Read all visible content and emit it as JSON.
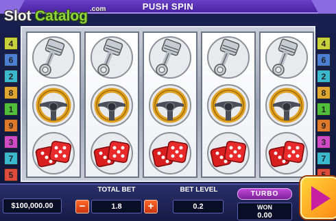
{
  "topbar": {
    "label": "PUSH SPIN"
  },
  "logo": {
    "part1": "Slot",
    "part2": "Catalog",
    "suffix": ".com"
  },
  "paylines": {
    "left": [
      {
        "n": "4",
        "color": "#c8d03a"
      },
      {
        "n": "6",
        "color": "#4a7fd4"
      },
      {
        "n": "2",
        "color": "#3ab8d0"
      },
      {
        "n": "8",
        "color": "#e0a830"
      },
      {
        "n": "1",
        "color": "#4fbf3a"
      },
      {
        "n": "9",
        "color": "#e07a2a"
      },
      {
        "n": "3",
        "color": "#d04ac8"
      },
      {
        "n": "7",
        "color": "#3ab8d0"
      },
      {
        "n": "5",
        "color": "#e04a3a"
      }
    ],
    "right": [
      {
        "n": "4",
        "color": "#c8d03a"
      },
      {
        "n": "6",
        "color": "#4a7fd4"
      },
      {
        "n": "2",
        "color": "#3ab8d0"
      },
      {
        "n": "8",
        "color": "#e0a830"
      },
      {
        "n": "1",
        "color": "#4fbf3a"
      },
      {
        "n": "9",
        "color": "#e07a2a"
      },
      {
        "n": "3",
        "color": "#d04ac8"
      },
      {
        "n": "7",
        "color": "#3ab8d0"
      },
      {
        "n": "5",
        "color": "#e04a3a"
      }
    ]
  },
  "reels": [
    [
      "piston-icon",
      "steering-wheel-icon",
      "dice-icon"
    ],
    [
      "piston-icon",
      "steering-wheel-icon",
      "dice-icon"
    ],
    [
      "piston-icon",
      "steering-wheel-icon",
      "dice-icon"
    ],
    [
      "piston-icon",
      "steering-wheel-icon",
      "dice-icon"
    ],
    [
      "piston-icon",
      "steering-wheel-icon",
      "dice-icon"
    ]
  ],
  "controls": {
    "balance": "$100,000.00",
    "total_bet_label": "TOTAL BET",
    "total_bet_value": "1.8",
    "minus": "−",
    "plus": "+",
    "bet_level_label": "BET LEVEL",
    "bet_level_value": "0.2",
    "turbo": "TURBO",
    "won_label": "WON",
    "won_value": "0.00"
  },
  "colors": {
    "accent": "#6a3fc9",
    "spin": "#ff8a14",
    "dice": "#d81e1e",
    "wheel": "#e0a020"
  }
}
